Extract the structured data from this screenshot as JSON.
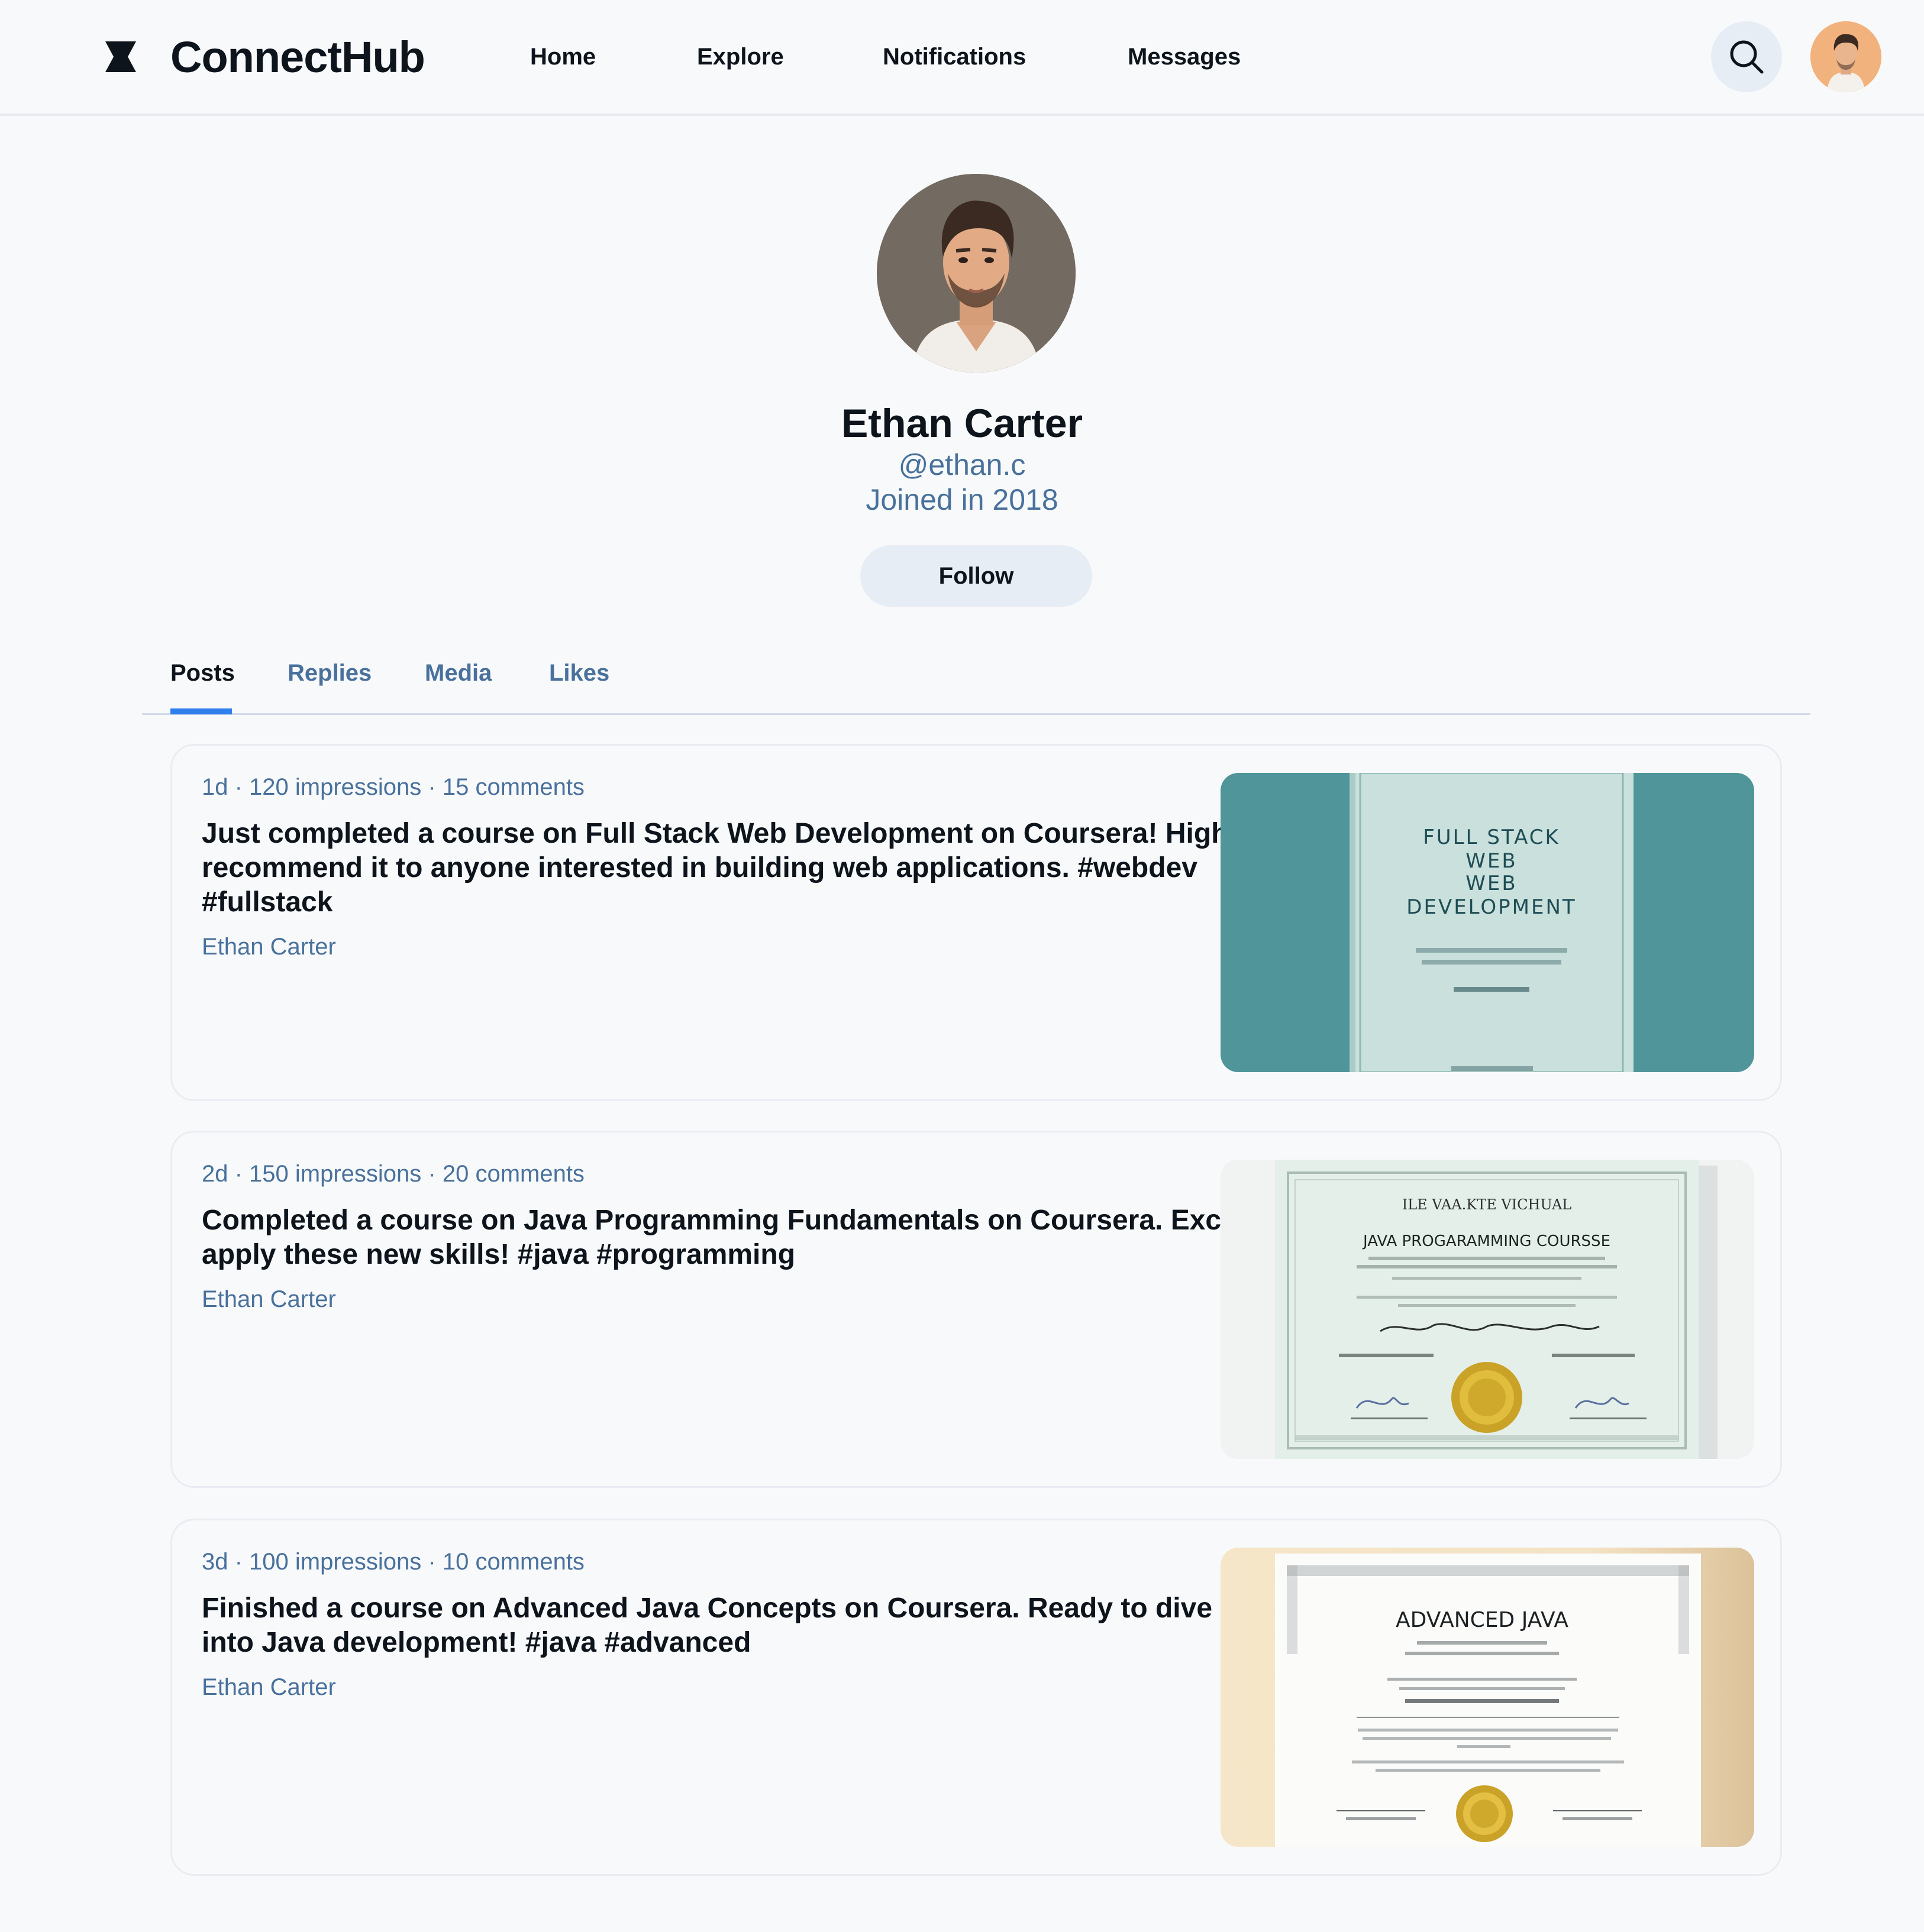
{
  "header": {
    "brand": "ConnectHub",
    "nav": [
      "Home",
      "Explore",
      "Notifications",
      "Messages"
    ],
    "search_icon": "search-icon",
    "logo_icon": "hourglass-logo-icon"
  },
  "profile": {
    "name": "Ethan Carter",
    "handle": "@ethan.c",
    "joined": "Joined in 2018",
    "follow_label": "Follow"
  },
  "tabs": [
    "Posts",
    "Replies",
    "Media",
    "Likes"
  ],
  "active_tab": "Posts",
  "posts": [
    {
      "meta": "1d · 120 impressions · 15 comments",
      "text": "Just completed a course on Full Stack Web Development on Coursera! Highly recommend it to anyone interested in building web applications. #webdev #fullstack",
      "author": "Ethan Carter",
      "image": {
        "title_lines": [
          "FULL STACK",
          "WEB",
          "WEB",
          "DEVELOPMENT"
        ]
      }
    },
    {
      "meta": "2d · 150 impressions · 20 comments",
      "text": "Completed a course on Java Programming Fundamentals on Coursera. Excited to apply these new skills! #java #programming",
      "author": "Ethan Carter",
      "image": {
        "heading": "ILE VAA.KTE VICHUAL",
        "title": "JAVA PROGARAMMING COURSSE"
      }
    },
    {
      "meta": "3d · 100 impressions · 10 comments",
      "text": "Finished a course on Advanced Java Concepts on Coursera. Ready to dive deeper into Java development! #java #advanced",
      "author": "Ethan Carter",
      "image": {
        "title": "ADVANCED JAVA"
      }
    }
  ],
  "colors": {
    "accent": "#2f80ed",
    "muted_text": "#49719c",
    "text": "#0d141c",
    "chip_bg": "#e7edf4"
  }
}
